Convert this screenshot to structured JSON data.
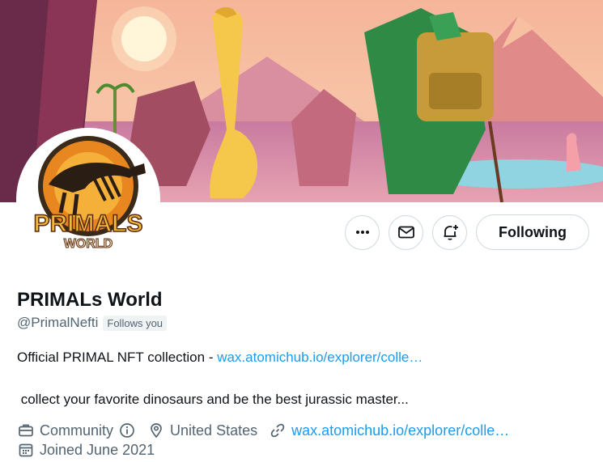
{
  "profile": {
    "display_name": "PRIMALs World",
    "handle": "@PrimalNefti",
    "follows_you": "Follows you",
    "bio_line1_text": "Official PRIMAL NFT collection - ",
    "bio_line1_link": "wax.atomichub.io/explorer/colle…",
    "bio_line2": " collect your favorite dinosaurs and be the best jurassic master..."
  },
  "avatar": {
    "logo_text_top": "PRIMALS",
    "logo_text_bottom": "WORLD"
  },
  "actions": {
    "more_icon": "more-icon",
    "message_icon": "envelope-icon",
    "notify_icon": "bell-plus-icon",
    "following_label": "Following"
  },
  "meta": {
    "category": "Community",
    "location": "United States",
    "website": "wax.atomichub.io/explorer/colle…",
    "joined": "Joined June 2021"
  },
  "colors": {
    "link": "#1d9bf0",
    "secondary_text": "#536471",
    "border": "#cfd9de"
  }
}
